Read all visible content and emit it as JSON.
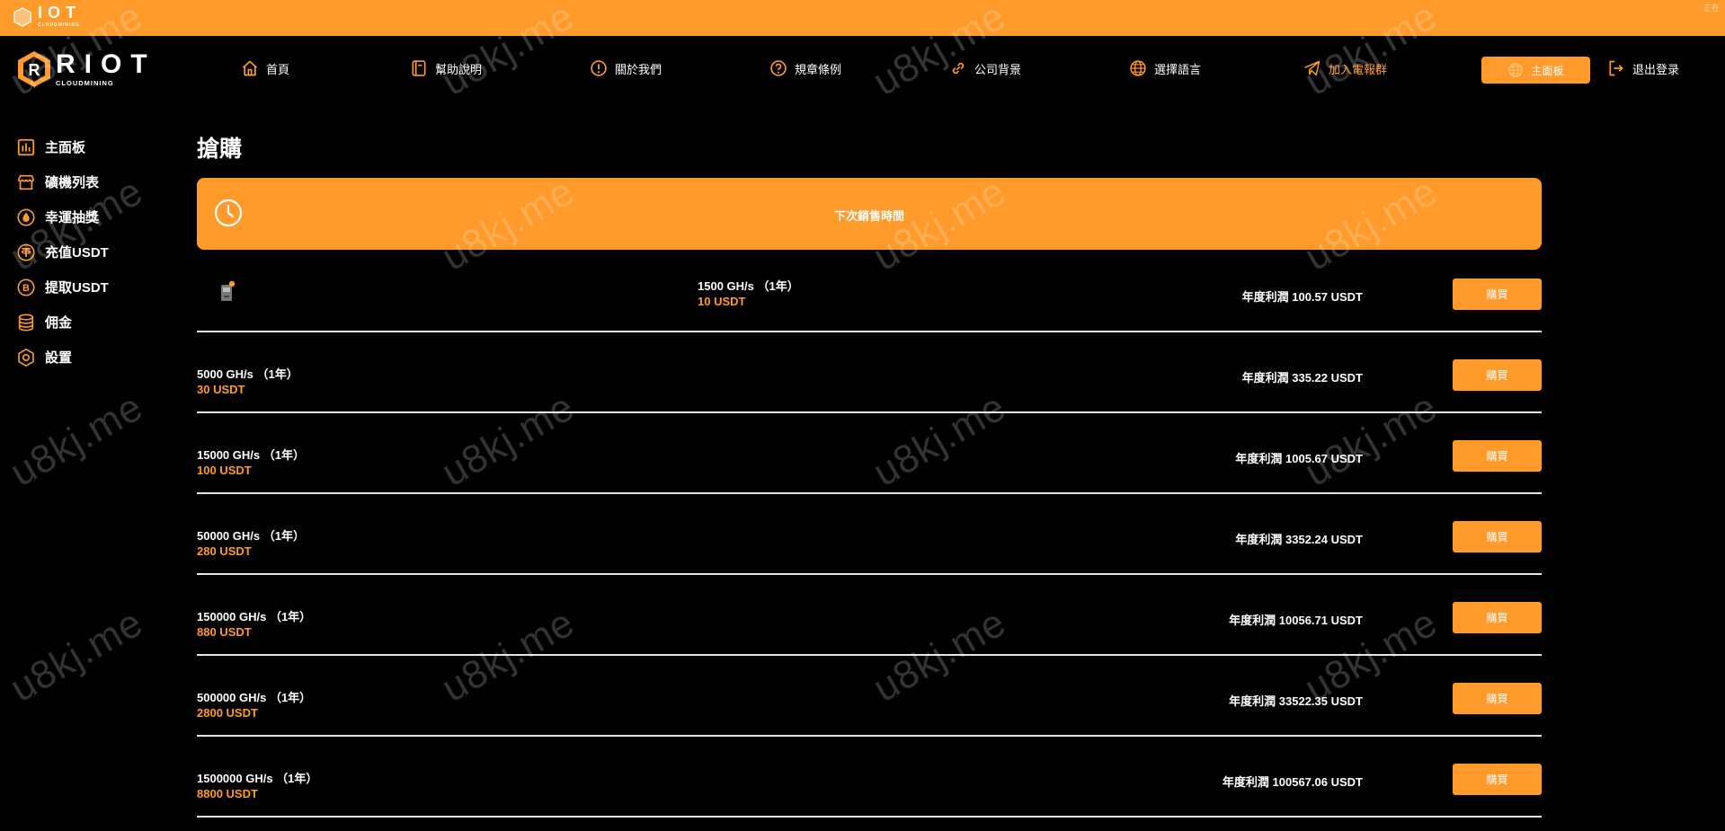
{
  "topbar": {
    "logo_text": "IOT",
    "logo_sub": "CLOUDMINING",
    "corner_text": "正在"
  },
  "brand": {
    "name": "RIOT",
    "sub": "CLOUDMINING"
  },
  "nav": {
    "items": [
      {
        "label": "首頁",
        "icon": "home-icon"
      },
      {
        "label": "幫助說明",
        "icon": "book-icon"
      },
      {
        "label": "關於我們",
        "icon": "info-icon"
      },
      {
        "label": "規章條例",
        "icon": "question-icon"
      },
      {
        "label": "公司背景",
        "icon": "link-icon"
      },
      {
        "label": "選擇語言",
        "icon": "globe-icon"
      },
      {
        "label": "加入電報群",
        "icon": "telegram-icon"
      }
    ],
    "dashboard_button": "主面板",
    "logout": "退出登录"
  },
  "sidebar": {
    "items": [
      {
        "label": "主面板",
        "icon": "chart-icon"
      },
      {
        "label": "礦機列表",
        "icon": "store-icon"
      },
      {
        "label": "幸運抽獎",
        "icon": "drop-icon"
      },
      {
        "label": "充值USDT",
        "icon": "tether-icon"
      },
      {
        "label": "提取USDT",
        "icon": "bitcoin-icon"
      },
      {
        "label": "佣金",
        "icon": "database-icon"
      },
      {
        "label": "設置",
        "icon": "settings-icon"
      }
    ]
  },
  "page": {
    "title": "搶購",
    "banner_text": "下次銷售時間"
  },
  "products": [
    {
      "spec": "1500 GH/s （1年）",
      "price": "10 USDT",
      "profit": "年度利潤 100.57 USDT",
      "buy": "購買"
    },
    {
      "spec": "5000 GH/s （1年）",
      "price": "30 USDT",
      "profit": "年度利潤 335.22 USDT",
      "buy": "購買"
    },
    {
      "spec": "15000 GH/s （1年）",
      "price": "100 USDT",
      "profit": "年度利潤 1005.67 USDT",
      "buy": "購買"
    },
    {
      "spec": "50000 GH/s （1年）",
      "price": "280 USDT",
      "profit": "年度利潤 3352.24 USDT",
      "buy": "購買"
    },
    {
      "spec": "150000 GH/s （1年）",
      "price": "880 USDT",
      "profit": "年度利潤 10056.71 USDT",
      "buy": "購買"
    },
    {
      "spec": "500000 GH/s （1年）",
      "price": "2800 USDT",
      "profit": "年度利潤 33522.35 USDT",
      "buy": "購買"
    },
    {
      "spec": "1500000 GH/s （1年）",
      "price": "8800 USDT",
      "profit": "年度利潤 100567.06 USDT",
      "buy": "購買"
    }
  ],
  "watermark": "u8kj.me",
  "colors": {
    "accent": "#ff9a2b",
    "background": "#000000",
    "divider": "#e6e6e6"
  }
}
